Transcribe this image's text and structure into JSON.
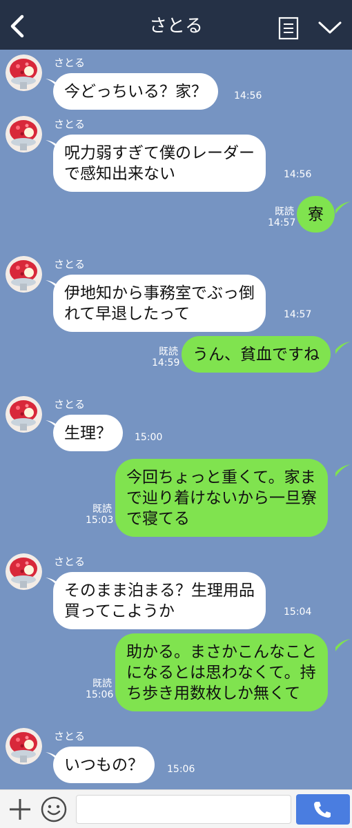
{
  "header": {
    "title": "さとる",
    "back_icon": "chevron-left-icon",
    "menu_icon": "notes-icon",
    "collapse_icon": "chevron-down-icon"
  },
  "theme": {
    "background": "#7694c2",
    "header_bg": "#253146",
    "bubble_in": "#ffffff",
    "bubble_out": "#80e34f",
    "call_button": "#4a7de0"
  },
  "messages": [
    {
      "sender": "さとる",
      "text": "今どっちいる？家？",
      "time": "14:56"
    },
    {
      "sender": "さとる",
      "text": "呪力弱すぎて僕のレーダー\nで感知出来ない",
      "time": "14:56"
    },
    {
      "text": "寮",
      "read": "既読",
      "time": "14:57"
    },
    {
      "sender": "さとる",
      "text": "伊地知から事務室でぶっ倒\nれて早退したって",
      "time": "14:57"
    },
    {
      "text": "うん、貧血ですね",
      "read": "既読",
      "time": "14:59"
    },
    {
      "sender": "さとる",
      "text": "生理？",
      "time": "15:00"
    },
    {
      "text": "今回ちょっと重くて。家ま\nで辿り着けないから一旦寮\nで寝てる",
      "read": "既読",
      "time": "15:03"
    },
    {
      "sender": "さとる",
      "text": "そのまま泊まる？生理用品\n買ってこようか",
      "time": "15:04"
    },
    {
      "text": "助かる。まさかこんなこと\nになるとは思わなくて。持\nち歩き用数枚しか無くて",
      "read": "既読",
      "time": "15:06"
    },
    {
      "sender": "さとる",
      "text": "いつもの？",
      "time": "15:06"
    }
  ],
  "footer": {
    "input_value": "",
    "plus_icon": "plus-icon",
    "sticker_icon": "smiley-icon",
    "call_icon": "phone-icon"
  }
}
